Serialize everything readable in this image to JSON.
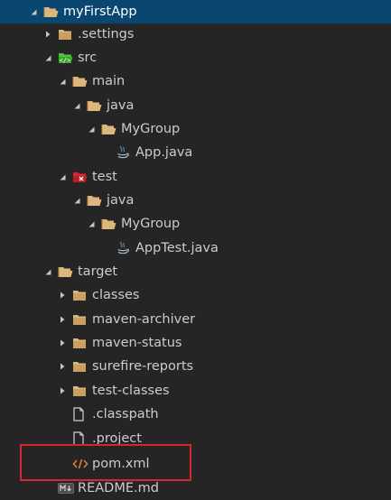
{
  "colors": {
    "background": "#252526",
    "selected_row": "#094771",
    "folder": "#dcb67a",
    "src_badge": "#4ec43b",
    "test_badge": "#d9262a",
    "xml": "#e37933",
    "highlight": "#d9262a"
  },
  "tree": [
    {
      "label": "myFirstApp",
      "twisty": "open",
      "icon": "folder-open-icon",
      "selected": true
    },
    {
      "label": ".settings",
      "twisty": "closed",
      "icon": "folder-icon"
    },
    {
      "label": "src",
      "twisty": "open",
      "icon": "src-folder-icon"
    },
    {
      "label": "main",
      "twisty": "open",
      "icon": "folder-open-icon"
    },
    {
      "label": "java",
      "twisty": "open",
      "icon": "folder-open-icon"
    },
    {
      "label": "MyGroup",
      "twisty": "open",
      "icon": "folder-open-icon"
    },
    {
      "label": "App.java",
      "twisty": "none",
      "icon": "java-file-icon"
    },
    {
      "label": "test",
      "twisty": "open",
      "icon": "test-folder-icon"
    },
    {
      "label": "java",
      "twisty": "open",
      "icon": "folder-open-icon"
    },
    {
      "label": "MyGroup",
      "twisty": "open",
      "icon": "folder-open-icon"
    },
    {
      "label": "AppTest.java",
      "twisty": "none",
      "icon": "java-file-icon"
    },
    {
      "label": "target",
      "twisty": "open",
      "icon": "folder-open-icon"
    },
    {
      "label": "classes",
      "twisty": "closed",
      "icon": "folder-icon"
    },
    {
      "label": "maven-archiver",
      "twisty": "closed",
      "icon": "folder-icon"
    },
    {
      "label": "maven-status",
      "twisty": "closed",
      "icon": "folder-icon"
    },
    {
      "label": "surefire-reports",
      "twisty": "closed",
      "icon": "folder-icon"
    },
    {
      "label": "test-classes",
      "twisty": "closed",
      "icon": "folder-icon"
    },
    {
      "label": ".classpath",
      "twisty": "none",
      "icon": "file-icon"
    },
    {
      "label": ".project",
      "twisty": "none",
      "icon": "file-icon"
    },
    {
      "label": "pom.xml",
      "twisty": "none",
      "icon": "xml-file-icon",
      "highlighted": true
    },
    {
      "label": "README.md",
      "twisty": "none",
      "icon": "markdown-file-icon"
    }
  ]
}
